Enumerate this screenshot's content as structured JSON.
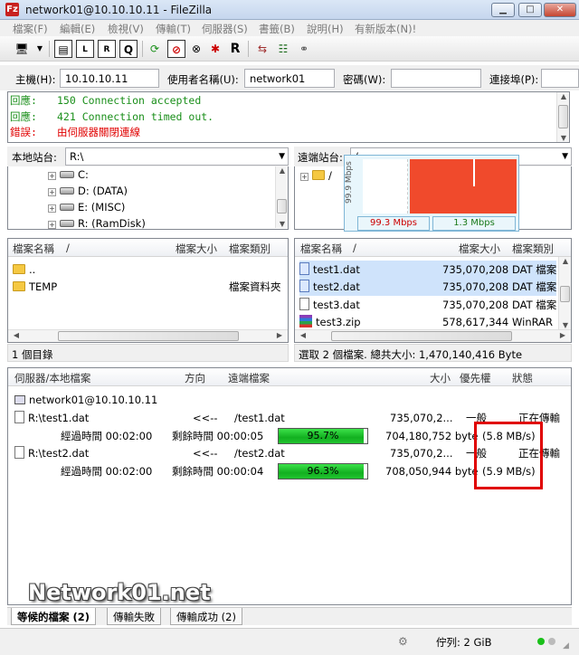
{
  "window": {
    "title": "network01@10.10.10.11 - FileZilla",
    "app_icon": "Fz"
  },
  "menu": [
    "檔案(F)",
    "編輯(E)",
    "檢視(V)",
    "傳輸(T)",
    "伺服器(S)",
    "書籤(B)",
    "說明(H)",
    "有新版本(N)!"
  ],
  "quickconnect": {
    "host_label": "主機(H):",
    "host": "10.10.10.11",
    "user_label": "使用者名稱(U):",
    "user": "network01",
    "pass_label": "密碼(W):",
    "port_label": "連接埠(P):"
  },
  "log": [
    {
      "tag": "回應:",
      "msg": "150 Connection accepted",
      "color": "#1a8f1a"
    },
    {
      "tag": "回應:",
      "msg": "421 Connection timed out.",
      "color": "#1a8f1a"
    },
    {
      "tag": "錯誤:",
      "msg": "由伺服器關閉連線",
      "color": "#e00000"
    }
  ],
  "local": {
    "site_label": "本地站台:",
    "path": "R:\\",
    "drives": [
      "C:",
      "D: (DATA)",
      "E: (MISC)",
      "R: (RamDisk)"
    ],
    "headers": {
      "name": "檔案名稱",
      "sort": "/",
      "size": "檔案大小",
      "type": "檔案類別"
    },
    "files": [
      {
        "name": ".."
      },
      {
        "name": "TEMP",
        "type": "檔案資料夾"
      }
    ],
    "status": "1 個目錄"
  },
  "remote": {
    "site_label": "遠端站台:",
    "path": "/",
    "tree_root": "/",
    "speed": {
      "axis": "99.9 Mbps",
      "down": "99.3 Mbps",
      "up": "1.3 Mbps"
    },
    "headers": {
      "name": "檔案名稱",
      "sort": "/",
      "size": "檔案大小",
      "type": "檔案類別"
    },
    "files": [
      {
        "name": "test1.dat",
        "size": "735,070,208",
        "type": "DAT 檔案"
      },
      {
        "name": "test2.dat",
        "size": "735,070,208",
        "type": "DAT 檔案"
      },
      {
        "name": "test3.dat",
        "size": "735,070,208",
        "type": "DAT 檔案"
      },
      {
        "name": "test3.zip",
        "size": "578,617,344",
        "type": "WinRAR"
      }
    ],
    "status": "選取 2 個檔案. 總共大小: 1,470,140,416 Byte"
  },
  "queue": {
    "headers": {
      "server": "伺服器/本地檔案",
      "dir": "方向",
      "remote": "遠端檔案",
      "size": "大小",
      "priority": "優先權",
      "status": "狀態"
    },
    "server": "network01@10.10.10.11",
    "items": [
      {
        "local": "R:\\test1.dat",
        "dir": "<<--",
        "remote": "/test1.dat",
        "size": "735,070,2...",
        "priority": "一般",
        "status": "正在傳輸",
        "elapsed": "經過時間 00:02:00",
        "remaining": "剩餘時間 00:00:05",
        "percent": "95.7%",
        "progress": 0.957,
        "bytes": "704,180,752 byte",
        "rate": "(5.8 MB/s)"
      },
      {
        "local": "R:\\test2.dat",
        "dir": "<<--",
        "remote": "/test2.dat",
        "size": "735,070,2...",
        "priority": "一般",
        "status": "正在傳輸",
        "elapsed": "經過時間 00:02:00",
        "remaining": "剩餘時間 00:00:04",
        "percent": "96.3%",
        "progress": 0.963,
        "bytes": "708,050,944 byte",
        "rate": "(5.9 MB/s)"
      }
    ]
  },
  "watermark": "Network01.net",
  "tabs": [
    "等候的檔案 (2)",
    "傳輸失敗",
    "傳輸成功 (2)"
  ],
  "bottom": {
    "queue": "佇列: 2 GiB"
  },
  "colors": {
    "highlight": "#e00000",
    "progress": "#12b020",
    "graph": "#f04a2c"
  }
}
